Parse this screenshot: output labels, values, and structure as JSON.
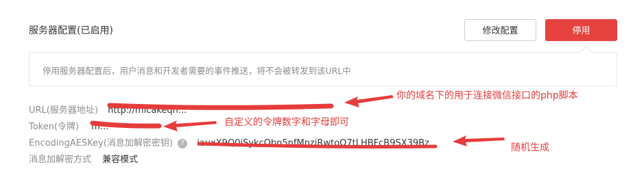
{
  "header": {
    "title": "服务器配置(已启用)",
    "edit_label": "修改配置",
    "stop_label": "停用"
  },
  "notice": {
    "text": "停用服务器配置后，用户消息和开发者需要的事件推送，将不会被转发到该URL中"
  },
  "fields": {
    "url_label": "URL(服务器地址)",
    "url_value": "http://micakeqn...",
    "token_label": "Token(令牌)",
    "token_value": "m...",
    "aes_label": "EncodingAESKey(消息加解密密钥)",
    "aes_value": "iauxX9Q0iSykcObn5nfMnziRwtoO7tLHBFcB9SX39Bz",
    "mode_label": "消息加解密方式",
    "mode_value": "兼容模式"
  },
  "annotations": {
    "url_note": "你的域名下的用于连接微信接口的php脚本",
    "token_note": "自定义的令牌数字和字母即可",
    "aes_note": "随机生成"
  },
  "colors": {
    "danger": "#e64340",
    "annotation": "#e63c3c",
    "muted_text": "#8d8d8d"
  },
  "icons": {
    "help": "question-circle-icon",
    "arrow": "red-arrow"
  }
}
